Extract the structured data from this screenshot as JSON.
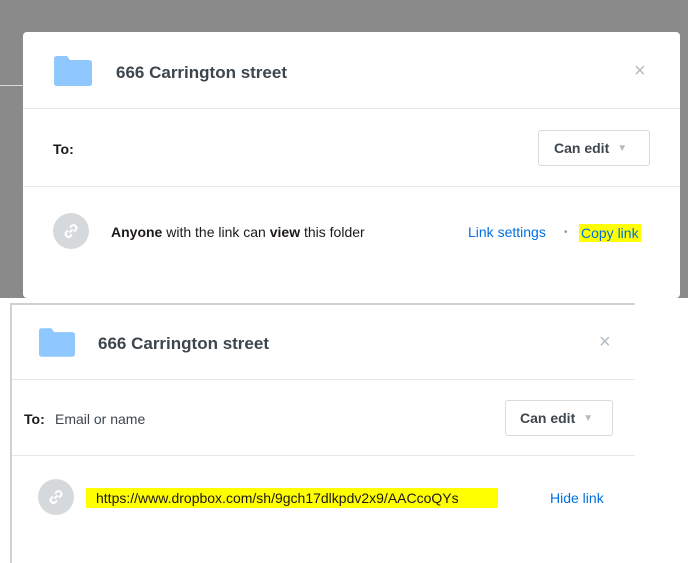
{
  "share_dialog_top": {
    "title": "666 Carrington street",
    "close_glyph": "×",
    "to_label": "To:",
    "permission": "Can edit",
    "link_text": {
      "bold1": "Anyone",
      "mid1": " with the link can ",
      "bold2": "view",
      "end": " this folder"
    },
    "link_settings": "Link settings",
    "separator": "•",
    "copy_link": "Copy link"
  },
  "share_dialog_bottom": {
    "title": "666 Carrington street",
    "close_glyph": "×",
    "to_label": "To:",
    "to_placeholder": "Email or name",
    "permission": "Can edit",
    "url": "https://www.dropbox.com/sh/9gch17dlkpdv2x9/AACcoQYs",
    "hide_link": "Hide link"
  },
  "icons": {
    "folder": "folder-icon",
    "link": "link-icon",
    "close": "close-icon",
    "caret": "chevron-down-icon"
  },
  "colors": {
    "folder": "#8fc7ff",
    "link_blue": "#0070e0",
    "highlight": "#ffff00",
    "backdrop": "#8a8a8a"
  }
}
